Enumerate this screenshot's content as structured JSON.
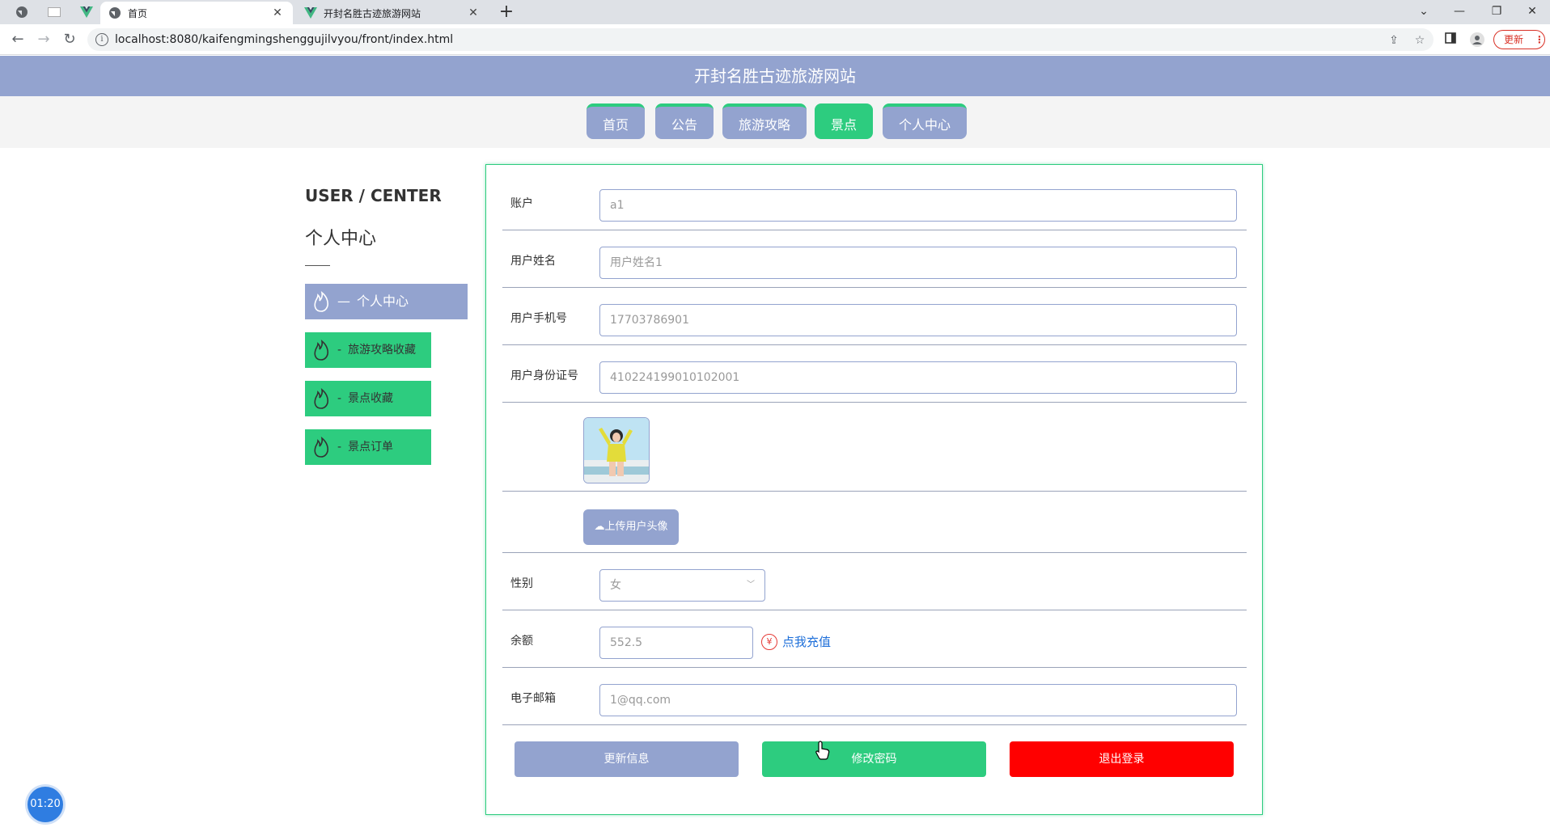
{
  "browser": {
    "tabs": [
      {
        "label": "首页",
        "active": true
      },
      {
        "label": "开封名胜古迹旅游网站",
        "active": false
      }
    ],
    "new_tab": "+",
    "url": "localhost:8080/kaifengmingshenggujilvyou/front/index.html",
    "update_label": "更新",
    "window_controls": [
      "⌄",
      "—",
      "❐",
      "✕"
    ]
  },
  "site": {
    "title": "开封名胜古迹旅游网站",
    "nav": [
      {
        "label": "首页"
      },
      {
        "label": "公告"
      },
      {
        "label": "旅游攻略"
      },
      {
        "label": "景点"
      },
      {
        "label": "个人中心"
      }
    ],
    "active_nav": "景点"
  },
  "sidebar": {
    "title": "USER / CENTER",
    "subtitle": "个人中心",
    "items": [
      {
        "label": "个人中心",
        "prefix": "—"
      },
      {
        "label": "旅游攻略收藏",
        "prefix": "-"
      },
      {
        "label": "景点收藏",
        "prefix": "-"
      },
      {
        "label": "景点订单",
        "prefix": "-"
      }
    ]
  },
  "form": {
    "account": {
      "label": "账户",
      "value": "a1"
    },
    "name": {
      "label": "用户姓名",
      "value": "用户姓名1"
    },
    "phone": {
      "label": "用户手机号",
      "value": "17703786901"
    },
    "idcard": {
      "label": "用户身份证号",
      "value": "410224199010102001"
    },
    "upload_label": "上传用户头像",
    "gender": {
      "label": "性别",
      "value": "女"
    },
    "balance": {
      "label": "余额",
      "value": "552.5",
      "recharge_label": "点我充值",
      "yen": "¥"
    },
    "email": {
      "label": "电子邮箱",
      "value": "1@qq.com"
    }
  },
  "actions": {
    "update": "更新信息",
    "change_password": "修改密码",
    "logout": "退出登录"
  },
  "timer": "01:20",
  "colors": {
    "primary": "#93a3cf",
    "accent": "#2dcc7f",
    "danger": "#ff0000"
  }
}
